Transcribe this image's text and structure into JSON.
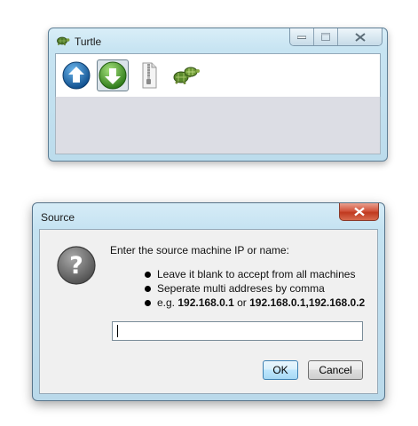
{
  "turtle_window": {
    "title": "Turtle",
    "toolbar": [
      {
        "icon": "upload-icon",
        "selected": false
      },
      {
        "icon": "download-icon",
        "selected": true
      },
      {
        "icon": "zip-file-icon",
        "selected": false
      },
      {
        "icon": "turtles-icon",
        "selected": false
      }
    ]
  },
  "source_dialog": {
    "title": "Source",
    "icon": "question-icon",
    "prompt": "Enter the source machine IP or name:",
    "bullet_1": "Leave it blank to accept from all machines",
    "bullet_2": "Seperate multi addreses by comma",
    "bullet_3_prefix": "e.g. ",
    "bullet_3_ip1": "192.168.0.1",
    "bullet_3_or": " or ",
    "bullet_3_ip2": "192.168.0.1,192.168.0.2",
    "input_value": "",
    "ok_label": "OK",
    "cancel_label": "Cancel"
  },
  "colors": {
    "frame": "#c4e2f1",
    "close_red": "#c9462b",
    "upload_blue": "#1f6fb2",
    "download_green": "#3f9a2a"
  }
}
